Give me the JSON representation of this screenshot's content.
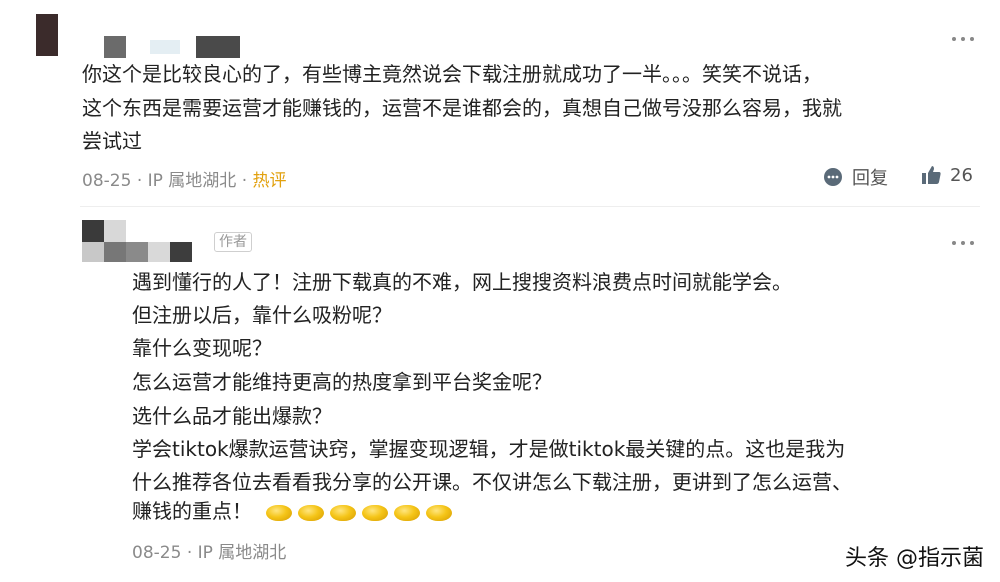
{
  "comment": {
    "text_lines": [
      "你这个是比较良心的了，有些博主竟然说会下载注册就成功了一半。。。笑笑不说话，",
      "这个东西是需要运营才能赚钱的，运营不是谁都会的，真想自己做号没那么容易，我就",
      "尝试过"
    ],
    "date": "08-25",
    "ip_label": "IP 属地湖北",
    "hot_badge": "热评",
    "reply_label": "回复",
    "like_count": "26",
    "icons": [
      "more-icon",
      "reply-icon",
      "thumbs-up-icon"
    ]
  },
  "reply": {
    "author_tag": "作者",
    "text_lines": [
      "遇到懂行的人了！注册下载真的不难，网上搜搜资料浪费点时间就能学会。",
      "但注册以后，靠什么吸粉呢？",
      "靠什么变现呢？",
      "怎么运营才能维持更高的热度拿到平台奖金呢？",
      "选什么品才能出爆款？",
      "学会tiktok爆款运营诀窍，掌握变现逻辑，才是做tiktok最关键的点。这也是我为",
      "什么推荐各位去看看我分享的公开课。不仅讲怎么下载注册，更讲到了怎么运营、",
      "赚钱的重点！"
    ],
    "emoji": "gold-ingot-emoji",
    "emoji_count": 6,
    "date": "08-25",
    "ip_label": "IP 属地湖北",
    "icons": [
      "more-icon"
    ]
  },
  "watermark": "头条 @指示菌",
  "colors": {
    "hot": "#e2a10f",
    "meta": "#8a8a8a",
    "text": "#222222"
  }
}
